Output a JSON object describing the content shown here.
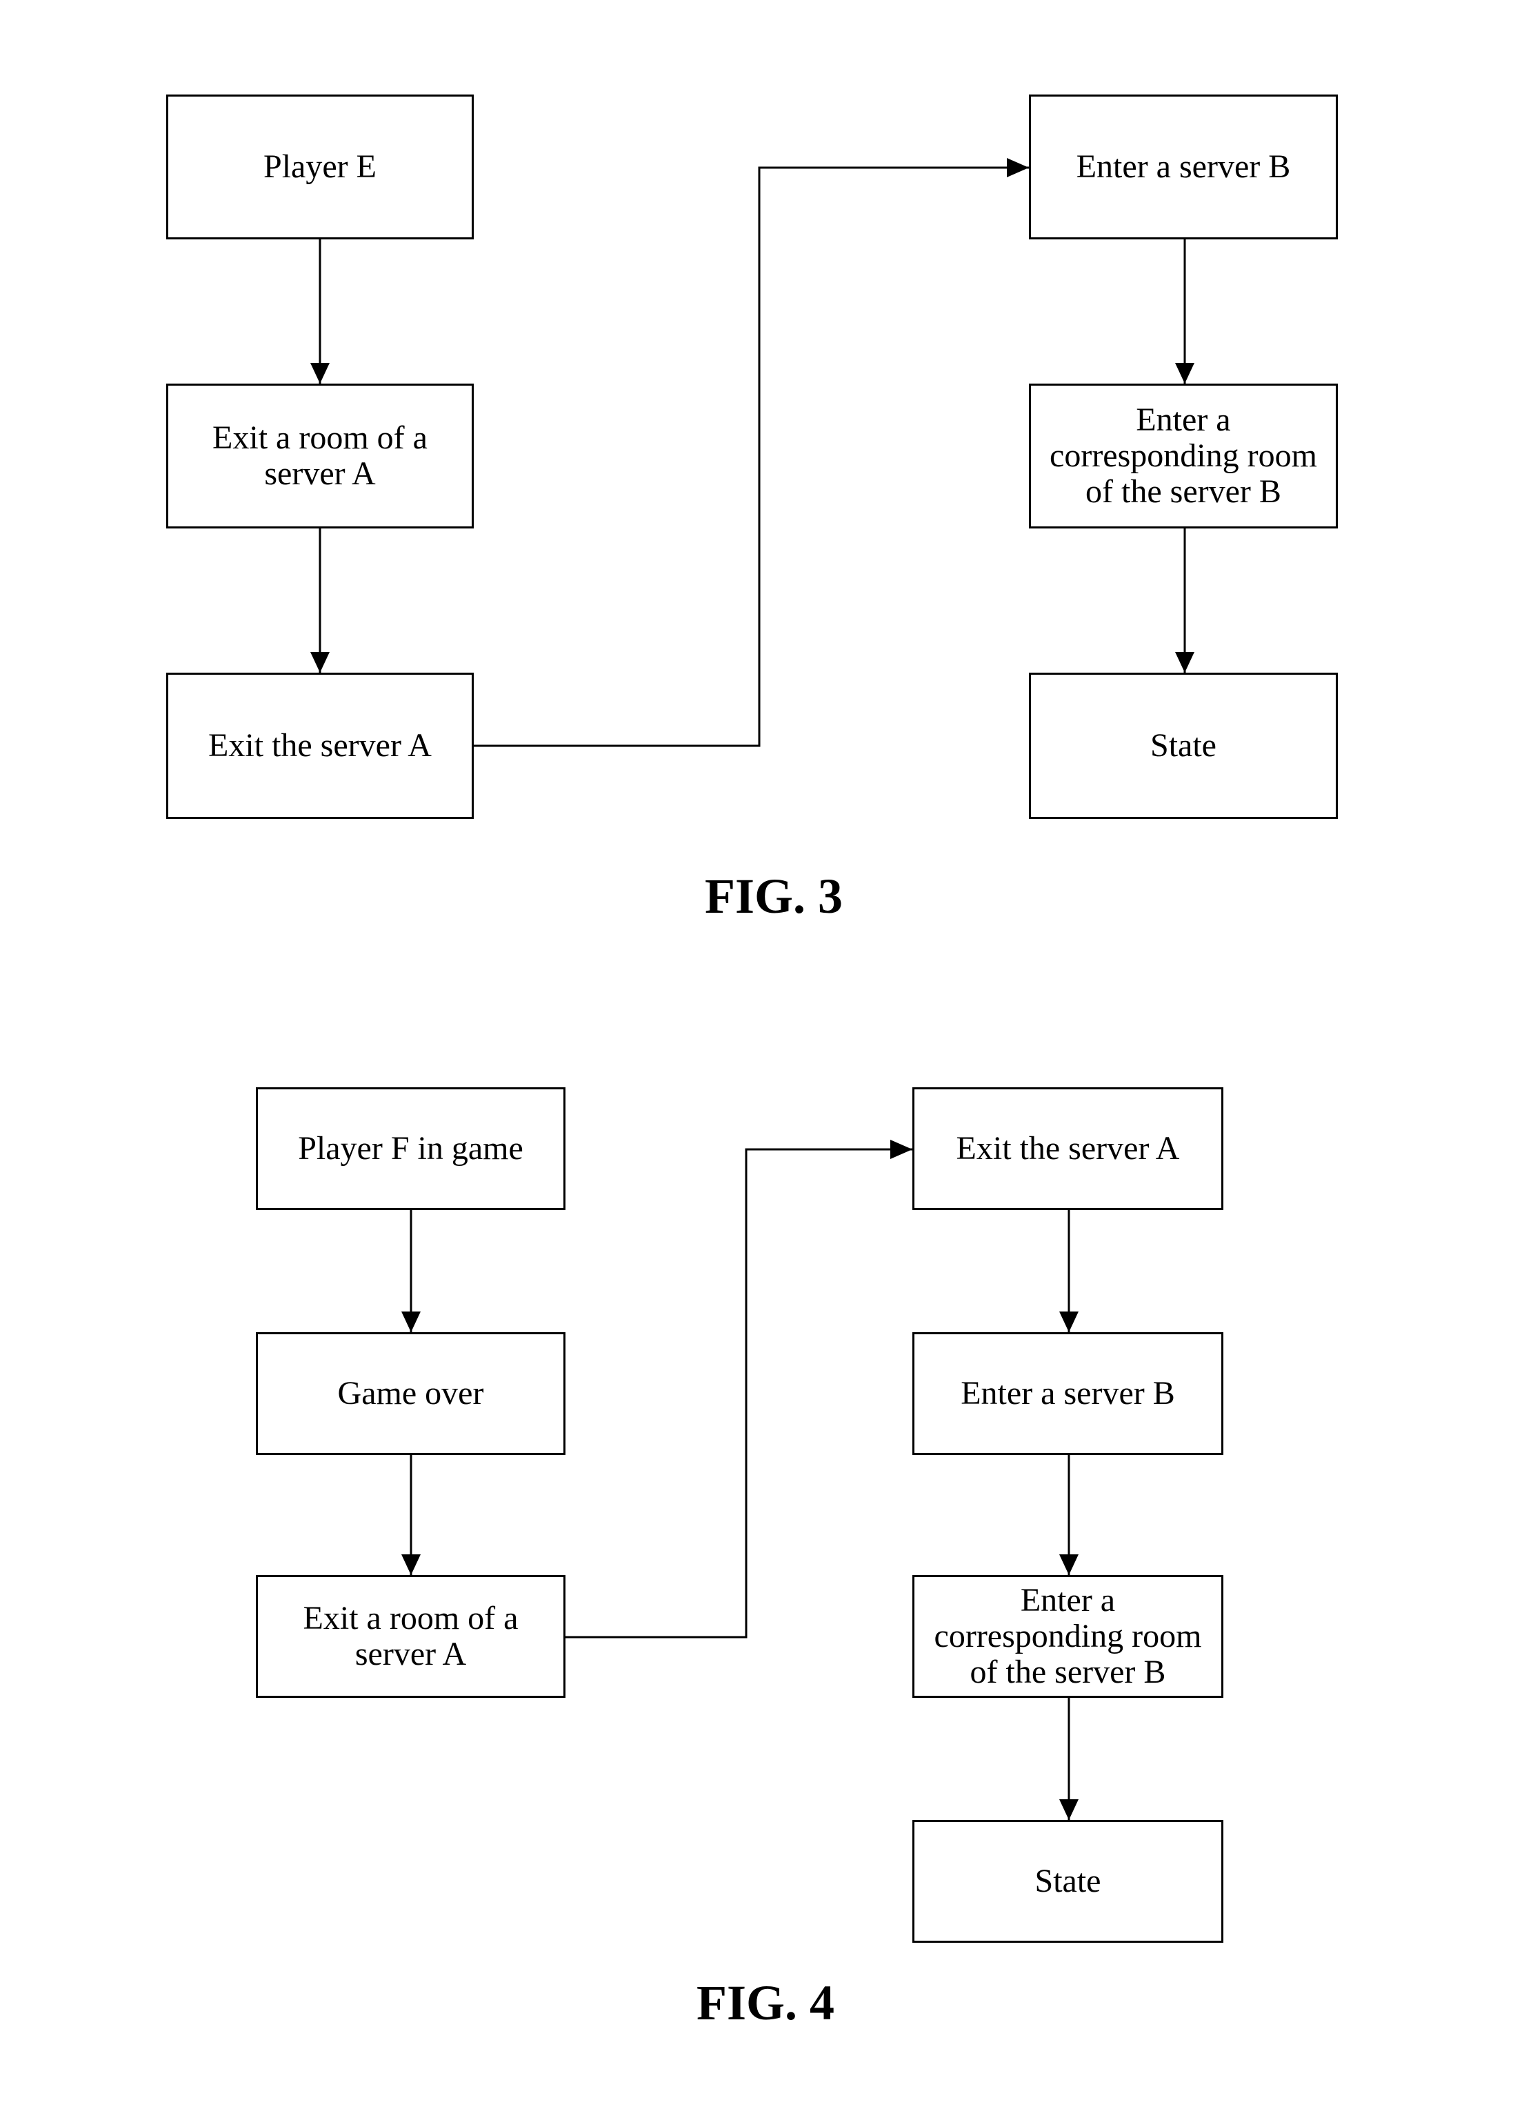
{
  "figures": [
    {
      "label": "FIG. 3",
      "nodes": {
        "player_e": "Player E",
        "exit_room_a": "Exit a room of a\nserver A",
        "exit_server_a": "Exit the server A",
        "enter_server_b": "Enter a server B",
        "enter_room_b": "Enter a\ncorresponding room\nof the server B",
        "state": "State"
      },
      "edges": [
        [
          "player_e",
          "exit_room_a"
        ],
        [
          "exit_room_a",
          "exit_server_a"
        ],
        [
          "exit_server_a",
          "enter_server_b"
        ],
        [
          "enter_server_b",
          "enter_room_b"
        ],
        [
          "enter_room_b",
          "state"
        ]
      ]
    },
    {
      "label": "FIG. 4",
      "nodes": {
        "player_f": "Player F in game",
        "game_over": "Game over",
        "exit_room_a": "Exit a room of a\nserver A",
        "exit_server_a": "Exit the server A",
        "enter_server_b": "Enter a server B",
        "enter_room_b": "Enter a\ncorresponding room\nof the server B",
        "state": "State"
      },
      "edges": [
        [
          "player_f",
          "game_over"
        ],
        [
          "game_over",
          "exit_room_a"
        ],
        [
          "exit_room_a",
          "exit_server_a"
        ],
        [
          "exit_server_a",
          "enter_server_b"
        ],
        [
          "enter_server_b",
          "enter_room_b"
        ],
        [
          "enter_room_b",
          "state"
        ]
      ]
    }
  ]
}
